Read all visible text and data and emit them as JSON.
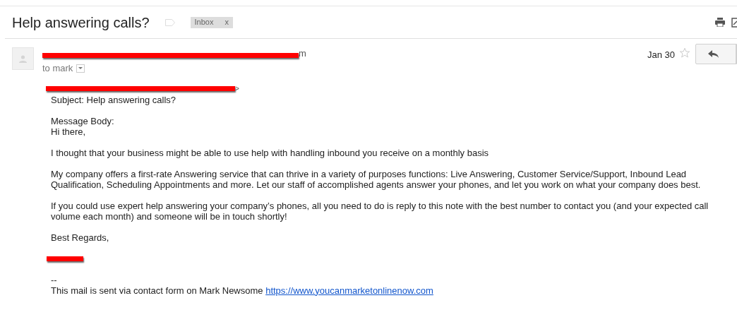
{
  "subject": "Help answering calls?",
  "labels": [
    {
      "text": "Inbox",
      "close": "x"
    }
  ],
  "message": {
    "sender_tail": "m",
    "recipient": "to mark",
    "date": "Jan 30",
    "starred": false,
    "from_tail": ">",
    "lines": [
      {
        "kind": "text",
        "text": "Subject: Help answering calls?"
      },
      {
        "kind": "gap"
      },
      {
        "kind": "text",
        "text": "Message Body:"
      },
      {
        "kind": "text",
        "text": "Hi there,"
      },
      {
        "kind": "gap"
      },
      {
        "kind": "text",
        "text": "I thought that your business might be able to use help with handling inbound you receive on a monthly basis"
      },
      {
        "kind": "gap"
      },
      {
        "kind": "text",
        "text": "My company offers a first-rate Answering service that can thrive in a variety of purposes functions: Live Answering, Customer Service/Support, Inbound Lead Qualification, Scheduling Appointments and more. Let our staff of accomplished agents answer your phones, and let you work on what your company does best."
      },
      {
        "kind": "gap"
      },
      {
        "kind": "text",
        "text": "If you could use expert help answering your company’s phones, all you need to do is reply to this note with the best number to contact you (and your expected call volume each month) and someone will be in touch shortly!"
      },
      {
        "kind": "gap"
      },
      {
        "kind": "text",
        "text": "Best Regards,"
      },
      {
        "kind": "gap"
      },
      {
        "kind": "redacted"
      },
      {
        "kind": "gap"
      },
      {
        "kind": "text",
        "text": "--"
      },
      {
        "kind": "link",
        "text": "This mail is sent via contact form on Mark Newsome ",
        "link": "https://www.youcanmarketonlinenow.com"
      }
    ]
  }
}
